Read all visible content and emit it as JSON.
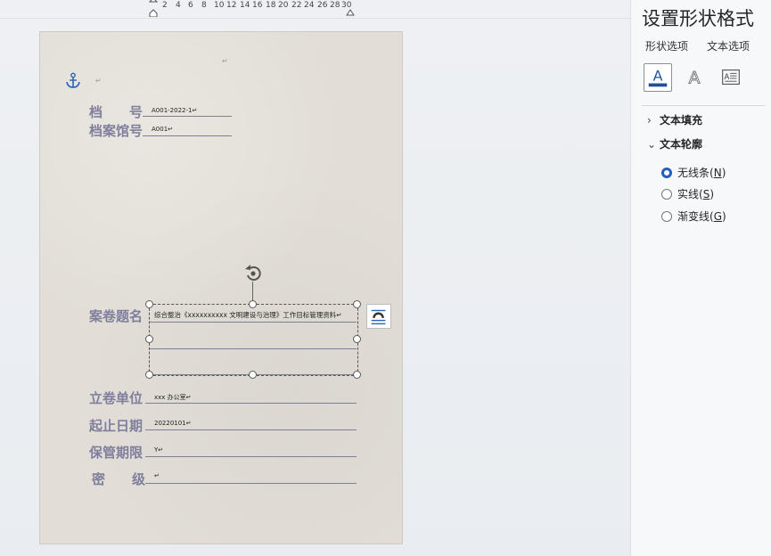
{
  "ruler": {
    "ticks": [
      "2",
      "4",
      "6",
      "8",
      "10",
      "12",
      "14",
      "16",
      "18",
      "20",
      "22",
      "24",
      "26",
      "28",
      "30"
    ]
  },
  "document": {
    "paragraph_mark": "↵",
    "fields": [
      {
        "label": "档　　号",
        "value": "A001-2022-1↵"
      },
      {
        "label": "档案馆号",
        "value": "A001↵"
      },
      {
        "label": "案卷题名",
        "value": "综合整治《xxxxxxxxxx 文明建设与治理》工作目标管理资料↵"
      },
      {
        "label": "立卷单位",
        "value": "xxx 办公室↵"
      },
      {
        "label": "起止日期",
        "value": "20220101↵"
      },
      {
        "label": "保管期限",
        "value": "Y↵"
      },
      {
        "label": "密　　级",
        "value": "↵"
      }
    ]
  },
  "panel": {
    "title": "设置形状格式",
    "subtabs": [
      "形状选项",
      "文本选项"
    ],
    "icon_tabs": [
      "text-fill-outline-icon",
      "text-effects-icon",
      "text-box-layout-icon"
    ],
    "sections": [
      {
        "label": "文本填充",
        "expanded": false
      },
      {
        "label": "文本轮廓",
        "expanded": true
      }
    ],
    "outline_options": [
      {
        "label": "无线条",
        "key": "N",
        "selected": true
      },
      {
        "label": "实线",
        "key": "S",
        "selected": false
      },
      {
        "label": "渐变线",
        "key": "G",
        "selected": false
      }
    ]
  },
  "colors": {
    "accent": "#1f5fbf",
    "label": "#7f7f9d"
  }
}
